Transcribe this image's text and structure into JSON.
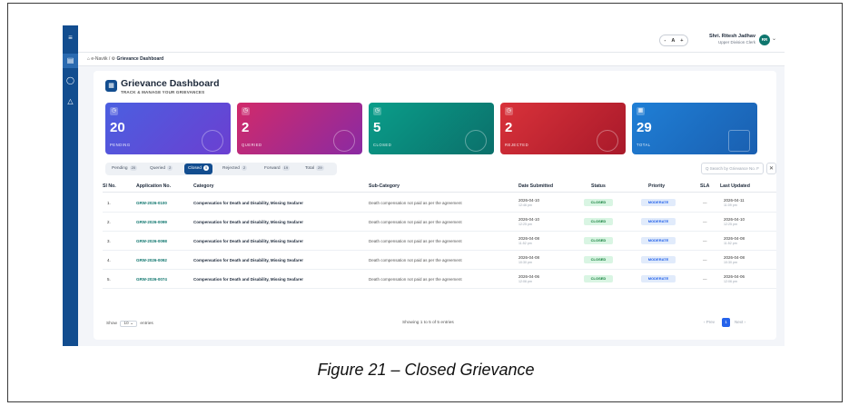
{
  "nav": {
    "menu_icon": "≡",
    "file_icon": "▤",
    "shield_icon": "◯",
    "bell_icon": "△"
  },
  "header": {
    "lang_minus": "-",
    "lang_label": "A",
    "lang_plus": "+",
    "user_name": "Shri. Ritesh Jadhav",
    "user_role": "Upper Division Clerk",
    "avatar_initials": "RR",
    "caret": "⌄"
  },
  "breadcrumb": {
    "home": "e-Naviik",
    "sep": "/",
    "current": "Grievance Dashboard"
  },
  "page": {
    "title": "Grievance Dashboard",
    "subtitle": "TRACK & MANAGE YOUR GRIEVANCES",
    "title_icon": "▦"
  },
  "cards": [
    {
      "value": "20",
      "label": "PENDING",
      "icon": "◷"
    },
    {
      "value": "2",
      "label": "QUERIED",
      "icon": "◷"
    },
    {
      "value": "5",
      "label": "CLOSED",
      "icon": "◷"
    },
    {
      "value": "2",
      "label": "REJECTED",
      "icon": "◷"
    },
    {
      "value": "29",
      "label": "TOTAL",
      "icon": "▦"
    }
  ],
  "tabs": [
    {
      "label": "Pending",
      "count": "20"
    },
    {
      "label": "Queried",
      "count": "2"
    },
    {
      "label": "Closed",
      "count": "5"
    },
    {
      "label": "Rejected",
      "count": "2"
    },
    {
      "label": "Forward",
      "count": "19"
    },
    {
      "label": "Total",
      "count": "29"
    }
  ],
  "search": {
    "placeholder": "Q  Search by Grievance No. F",
    "clear": "✕"
  },
  "table": {
    "headers": [
      "Sl No.",
      "Application No.",
      "Category",
      "Sub-Category",
      "Date Submitted",
      "Status",
      "Priority",
      "SLA",
      "Last Updated"
    ],
    "rows": [
      {
        "sn": "1.",
        "app": "GRW-2026-0100",
        "cat": "Compensation for Death and Disability, Missing Seafarer",
        "sub": "Death compensation not paid as per the agreement",
        "date": "2026-04-10",
        "time": "12:46 pm",
        "status": "CLOSED",
        "priority": "MODERATE",
        "sla": "—",
        "upd": "2026-04-11",
        "upd_time": "11:09 pm"
      },
      {
        "sn": "2.",
        "app": "GRW-2026-0099",
        "cat": "Compensation for Death and Disability, Missing Seafarer",
        "sub": "Death compensation not paid as per the agreement",
        "date": "2026-04-10",
        "time": "12:25 pm",
        "status": "CLOSED",
        "priority": "MODERATE",
        "sla": "—",
        "upd": "2026-04-10",
        "upd_time": "12:25 pm"
      },
      {
        "sn": "3.",
        "app": "GRW-2026-0098",
        "cat": "Compensation for Death and Disability, Missing Seafarer",
        "sub": "Death compensation not paid as per the agreement",
        "date": "2026-04-08",
        "time": "11:52 pm",
        "status": "CLOSED",
        "priority": "MODERATE",
        "sla": "—",
        "upd": "2026-04-08",
        "upd_time": "11:52 pm"
      },
      {
        "sn": "4.",
        "app": "GRW-2026-0092",
        "cat": "Compensation for Death and Disability, Missing Seafarer",
        "sub": "Death compensation not paid as per the agreement",
        "date": "2026-04-08",
        "time": "10:30 pm",
        "status": "CLOSED",
        "priority": "MODERATE",
        "sla": "—",
        "upd": "2026-04-08",
        "upd_time": "10:30 pm"
      },
      {
        "sn": "5.",
        "app": "GRW-2026-0074",
        "cat": "Compensation for Death and Disability, Missing Seafarer",
        "sub": "Death compensation not paid as per the agreement",
        "date": "2026-04-06",
        "time": "12:06 pm",
        "status": "CLOSED",
        "priority": "MODERATE",
        "sla": "—",
        "upd": "2026-04-06",
        "upd_time": "12:06 pm"
      }
    ]
  },
  "footer": {
    "show": "Show",
    "entries_value": "10",
    "entries": "entries",
    "summary": "Showing 1 to 5 of 5 entries",
    "prev": "‹ Prev",
    "page": "1",
    "next": "Next ›"
  },
  "caption": "Figure 21 – Closed Grievance",
  "colors": {
    "rail": "#124d8f",
    "pending": "#5b4fd6",
    "queried": "#c2286b",
    "closed": "#0d8f7f",
    "rejected": "#c1262e",
    "total": "#1f78d1"
  }
}
